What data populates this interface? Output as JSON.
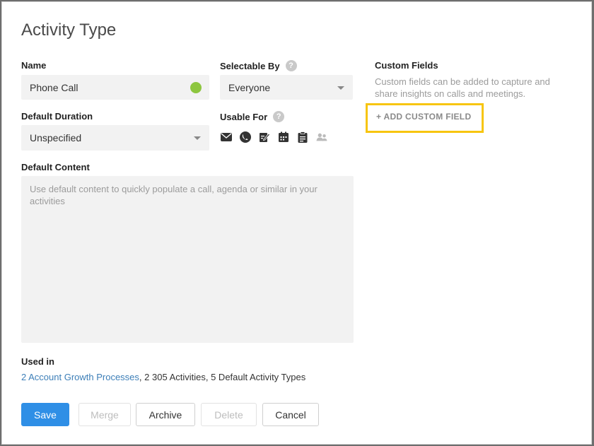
{
  "dialog": {
    "title": "Activity Type"
  },
  "name": {
    "label": "Name",
    "value": "Phone Call",
    "color": "#8dc63f"
  },
  "selectable_by": {
    "label": "Selectable By",
    "value": "Everyone",
    "help": "?"
  },
  "default_duration": {
    "label": "Default Duration",
    "value": "Unspecified"
  },
  "usable_for": {
    "label": "Usable For",
    "help": "?",
    "icons": [
      "email-icon",
      "phone-icon",
      "note-icon",
      "calendar-icon",
      "task-icon",
      "meeting-icon"
    ]
  },
  "default_content": {
    "label": "Default Content",
    "placeholder": "Use default content to quickly populate a call, agenda or similar in your activities"
  },
  "custom_fields": {
    "label": "Custom Fields",
    "description": "Custom fields can be added to capture and share insights on calls and meetings.",
    "add_label": "+ ADD CUSTOM FIELD",
    "highlight_color": "#f7c510"
  },
  "used_in": {
    "label": "Used in",
    "link_text": "2 Account Growth Processes",
    "rest_text": ", 2 305 Activities, 5 Default Activity Types"
  },
  "buttons": {
    "save": "Save",
    "merge": "Merge",
    "archive": "Archive",
    "delete": "Delete",
    "cancel": "Cancel"
  },
  "colors": {
    "primary": "#2f8fe6",
    "link": "#3d7fb8"
  }
}
